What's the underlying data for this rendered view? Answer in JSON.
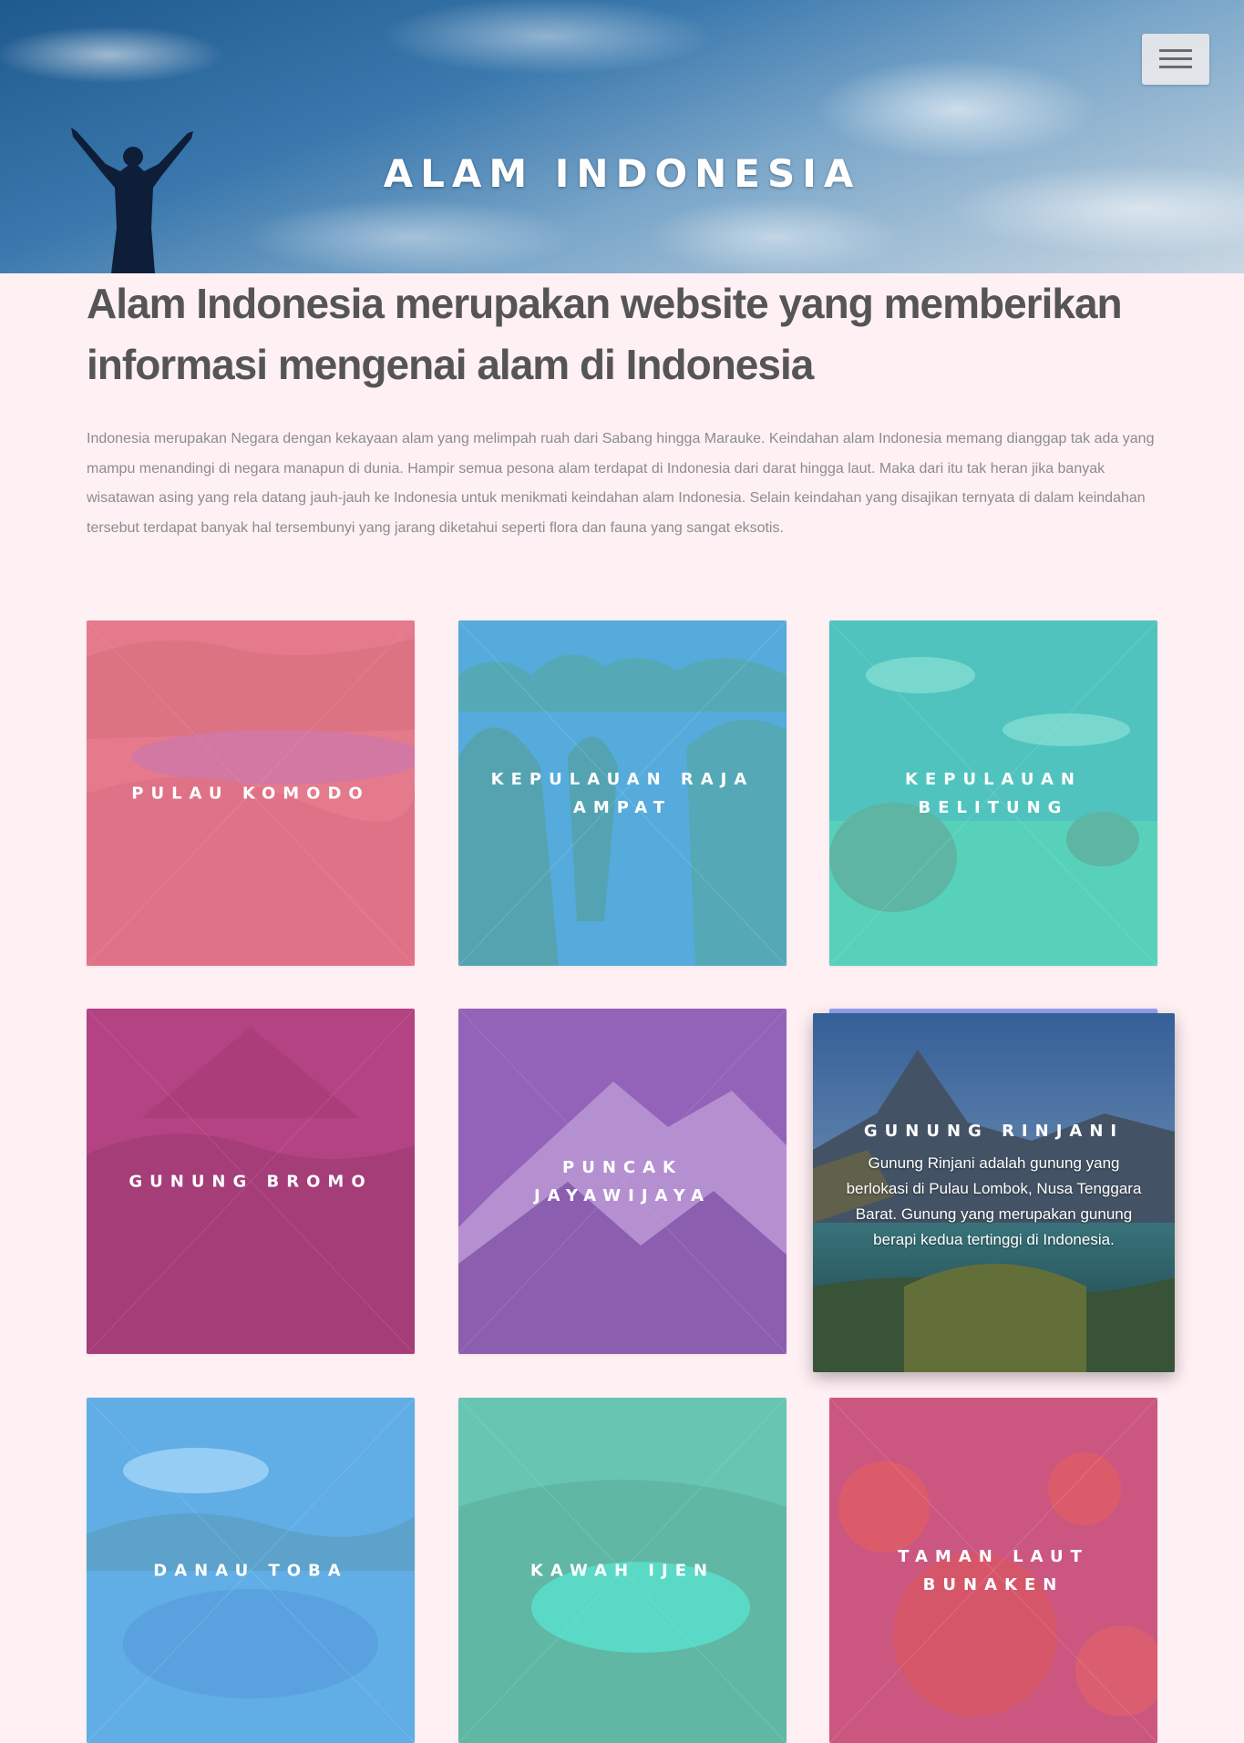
{
  "hero": {
    "title": "ALAM INDONESIA",
    "menu_icon": "hamburger-icon"
  },
  "headline": "Alam Indonesia merupakan website yang memberikan informasi mengenai alam di Indonesia",
  "intro": "Indonesia merupakan Negara dengan kekayaan alam yang melimpah ruah dari Sabang hingga Marauke. Keindahan alam Indonesia memang dianggap tak ada yang mampu menandingi di negara manapun di dunia. Hampir semua pesona alam terdapat di Indonesia dari darat hingga laut. Maka dari itu tak heran jika banyak wisatawan asing yang rela datang jauh-jauh ke Indonesia untuk menikmati keindahan alam Indonesia. Selain keindahan yang disajikan ternyata di dalam keindahan tersebut terdapat banyak hal tersembunyi yang jarang diketahui seperti flora dan fauna yang sangat eksotis.",
  "cards": [
    {
      "title": "PULAU KOMODO",
      "tint": "#f07a9e"
    },
    {
      "title": "KEPULAUAN RAJA AMPAT",
      "tint": "#6ec6f4"
    },
    {
      "title": "KEPULAUAN BELITUNG",
      "tint": "#5fd8c2"
    },
    {
      "title": "GUNUNG BROMO",
      "tint": "#c7478e"
    },
    {
      "title": "PUNCAK JAYAWIJAYA",
      "tint": "#a069c4"
    },
    {
      "title": "GUNUNG RINJANI",
      "tint": "#7a8ef0",
      "description": "Gunung Rinjani adalah gunung yang berlokasi di Pulau Lombok, Nusa Tenggara Barat. Gunung yang merupakan gunung berapi kedua tertinggi di Indonesia."
    },
    {
      "title": "DANAU TOBA",
      "tint": "#6fbdf4"
    },
    {
      "title": "KAWAH IJEN",
      "tint": "#62d4c0"
    },
    {
      "title": "TAMAN LAUT BUNAKEN",
      "tint": "#e0608f"
    }
  ]
}
